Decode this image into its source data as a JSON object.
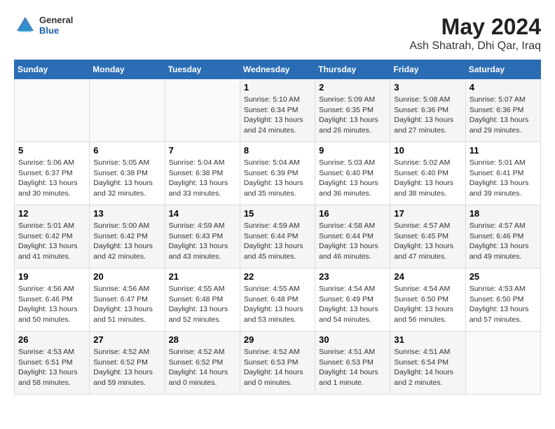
{
  "header": {
    "logo": {
      "general": "General",
      "blue": "Blue"
    },
    "title": "May 2024",
    "subtitle": "Ash Shatrah, Dhi Qar, Iraq"
  },
  "days_of_week": [
    "Sunday",
    "Monday",
    "Tuesday",
    "Wednesday",
    "Thursday",
    "Friday",
    "Saturday"
  ],
  "weeks": [
    [
      {
        "day": "",
        "info": ""
      },
      {
        "day": "",
        "info": ""
      },
      {
        "day": "",
        "info": ""
      },
      {
        "day": "1",
        "info": "Sunrise: 5:10 AM\nSunset: 6:34 PM\nDaylight: 13 hours\nand 24 minutes."
      },
      {
        "day": "2",
        "info": "Sunrise: 5:09 AM\nSunset: 6:35 PM\nDaylight: 13 hours\nand 26 minutes."
      },
      {
        "day": "3",
        "info": "Sunrise: 5:08 AM\nSunset: 6:36 PM\nDaylight: 13 hours\nand 27 minutes."
      },
      {
        "day": "4",
        "info": "Sunrise: 5:07 AM\nSunset: 6:36 PM\nDaylight: 13 hours\nand 29 minutes."
      }
    ],
    [
      {
        "day": "5",
        "info": "Sunrise: 5:06 AM\nSunset: 6:37 PM\nDaylight: 13 hours\nand 30 minutes."
      },
      {
        "day": "6",
        "info": "Sunrise: 5:05 AM\nSunset: 6:38 PM\nDaylight: 13 hours\nand 32 minutes."
      },
      {
        "day": "7",
        "info": "Sunrise: 5:04 AM\nSunset: 6:38 PM\nDaylight: 13 hours\nand 33 minutes."
      },
      {
        "day": "8",
        "info": "Sunrise: 5:04 AM\nSunset: 6:39 PM\nDaylight: 13 hours\nand 35 minutes."
      },
      {
        "day": "9",
        "info": "Sunrise: 5:03 AM\nSunset: 6:40 PM\nDaylight: 13 hours\nand 36 minutes."
      },
      {
        "day": "10",
        "info": "Sunrise: 5:02 AM\nSunset: 6:40 PM\nDaylight: 13 hours\nand 38 minutes."
      },
      {
        "day": "11",
        "info": "Sunrise: 5:01 AM\nSunset: 6:41 PM\nDaylight: 13 hours\nand 39 minutes."
      }
    ],
    [
      {
        "day": "12",
        "info": "Sunrise: 5:01 AM\nSunset: 6:42 PM\nDaylight: 13 hours\nand 41 minutes."
      },
      {
        "day": "13",
        "info": "Sunrise: 5:00 AM\nSunset: 6:42 PM\nDaylight: 13 hours\nand 42 minutes."
      },
      {
        "day": "14",
        "info": "Sunrise: 4:59 AM\nSunset: 6:43 PM\nDaylight: 13 hours\nand 43 minutes."
      },
      {
        "day": "15",
        "info": "Sunrise: 4:59 AM\nSunset: 6:44 PM\nDaylight: 13 hours\nand 45 minutes."
      },
      {
        "day": "16",
        "info": "Sunrise: 4:58 AM\nSunset: 6:44 PM\nDaylight: 13 hours\nand 46 minutes."
      },
      {
        "day": "17",
        "info": "Sunrise: 4:57 AM\nSunset: 6:45 PM\nDaylight: 13 hours\nand 47 minutes."
      },
      {
        "day": "18",
        "info": "Sunrise: 4:57 AM\nSunset: 6:46 PM\nDaylight: 13 hours\nand 49 minutes."
      }
    ],
    [
      {
        "day": "19",
        "info": "Sunrise: 4:56 AM\nSunset: 6:46 PM\nDaylight: 13 hours\nand 50 minutes."
      },
      {
        "day": "20",
        "info": "Sunrise: 4:56 AM\nSunset: 6:47 PM\nDaylight: 13 hours\nand 51 minutes."
      },
      {
        "day": "21",
        "info": "Sunrise: 4:55 AM\nSunset: 6:48 PM\nDaylight: 13 hours\nand 52 minutes."
      },
      {
        "day": "22",
        "info": "Sunrise: 4:55 AM\nSunset: 6:48 PM\nDaylight: 13 hours\nand 53 minutes."
      },
      {
        "day": "23",
        "info": "Sunrise: 4:54 AM\nSunset: 6:49 PM\nDaylight: 13 hours\nand 54 minutes."
      },
      {
        "day": "24",
        "info": "Sunrise: 4:54 AM\nSunset: 6:50 PM\nDaylight: 13 hours\nand 56 minutes."
      },
      {
        "day": "25",
        "info": "Sunrise: 4:53 AM\nSunset: 6:50 PM\nDaylight: 13 hours\nand 57 minutes."
      }
    ],
    [
      {
        "day": "26",
        "info": "Sunrise: 4:53 AM\nSunset: 6:51 PM\nDaylight: 13 hours\nand 58 minutes."
      },
      {
        "day": "27",
        "info": "Sunrise: 4:52 AM\nSunset: 6:52 PM\nDaylight: 13 hours\nand 59 minutes."
      },
      {
        "day": "28",
        "info": "Sunrise: 4:52 AM\nSunset: 6:52 PM\nDaylight: 14 hours\nand 0 minutes."
      },
      {
        "day": "29",
        "info": "Sunrise: 4:52 AM\nSunset: 6:53 PM\nDaylight: 14 hours\nand 0 minutes."
      },
      {
        "day": "30",
        "info": "Sunrise: 4:51 AM\nSunset: 6:53 PM\nDaylight: 14 hours\nand 1 minute."
      },
      {
        "day": "31",
        "info": "Sunrise: 4:51 AM\nSunset: 6:54 PM\nDaylight: 14 hours\nand 2 minutes."
      },
      {
        "day": "",
        "info": ""
      }
    ]
  ]
}
